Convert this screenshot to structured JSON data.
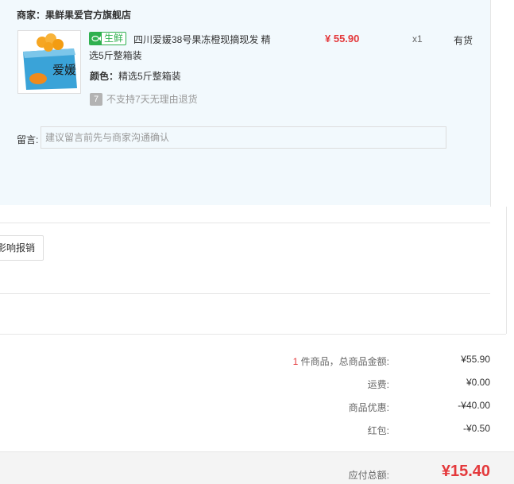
{
  "store": {
    "label": "商家：",
    "name": "果鲜果爱官方旗舰店"
  },
  "item": {
    "badge": "生鲜",
    "title": "四川爱媛38号果冻橙现摘现发 精选5斤整箱装",
    "price": "¥ 55.90",
    "qty": "x1",
    "stock": "有货",
    "spec_key": "颜色：",
    "spec_val": "精选5斤整箱装",
    "return_policy": "不支持7天无理由退货",
    "image_text": "爱媛",
    "return_icon": "7"
  },
  "message": {
    "label": "留言:",
    "placeholder": "建议留言前先与商家沟通确认"
  },
  "report_button": "影响报销",
  "summary": {
    "count": "1",
    "count_label": "件商品，总商品金额:",
    "goods_total": "¥55.90",
    "shipping_label": "运费:",
    "shipping": "¥0.00",
    "discount_label": "商品优惠:",
    "discount": "-¥40.00",
    "redpacket_label": "红包:",
    "redpacket": "-¥0.50",
    "payable_label": "应付总额:",
    "payable": "¥15.40"
  },
  "colors": {
    "price_red": "#e4393c",
    "fresh_green": "#2fb04f",
    "panel_bg": "#f2f9fd"
  }
}
